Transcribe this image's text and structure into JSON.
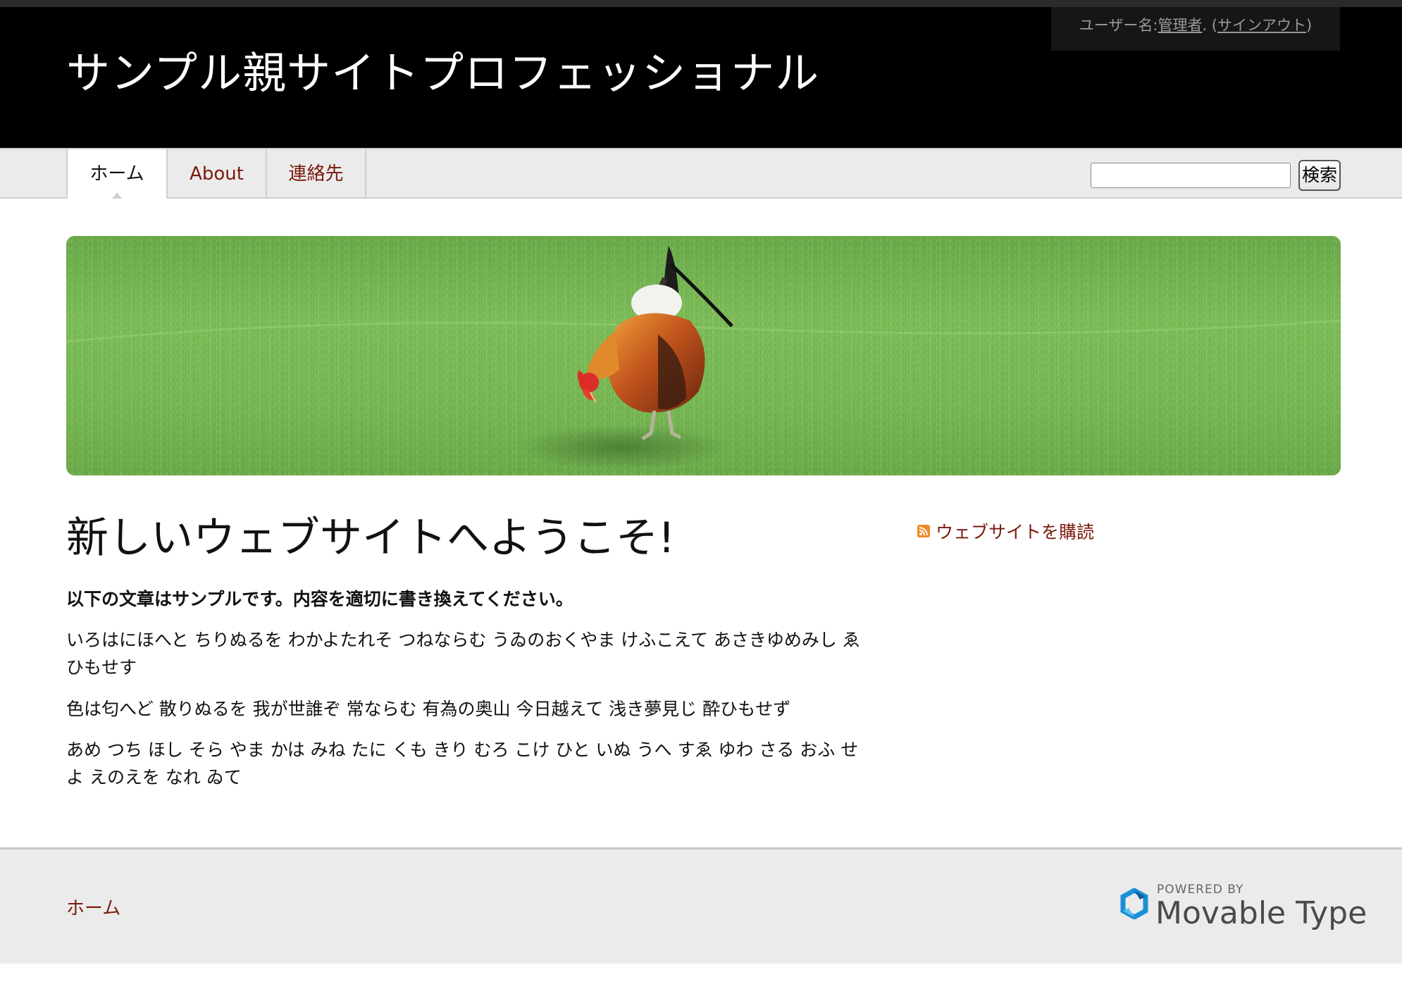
{
  "header": {
    "site_title": "サンプル親サイトプロフェッショナル",
    "user": {
      "prefix": "ユーザー名:",
      "username": "管理者",
      "separator": ". (",
      "signout": "サインアウト",
      "suffix": ")"
    }
  },
  "nav": {
    "tabs": [
      {
        "label": "ホーム",
        "active": true
      },
      {
        "label": "About",
        "active": false
      },
      {
        "label": "連絡先",
        "active": false
      }
    ],
    "search": {
      "value": "",
      "button_label": "検索"
    }
  },
  "banner": {
    "description_icon": "rooster-photo"
  },
  "main": {
    "heading": "新しいウェブサイトへようこそ!",
    "lead": "以下の文章はサンプルです。内容を適切に書き換えてください。",
    "paragraphs": [
      "いろはにほへと ちりぬるを わかよたれそ つねならむ うゐのおくやま けふこえて あさきゆめみし ゑひもせす",
      "色は匂へど 散りぬるを 我が世誰ぞ 常ならむ 有為の奥山 今日越えて 浅き夢見じ 酔ひもせず",
      "あめ つち ほし そら やま かは みね たに くも きり むろ こけ ひと いぬ うへ すゑ ゆわ さる おふ せよ えのえを なれ ゐて"
    ]
  },
  "sidebar": {
    "subscribe_label": "ウェブサイトを購読",
    "subscribe_icon": "rss-feed-icon"
  },
  "footer": {
    "home_link": "ホーム",
    "powered_by": "POWERED BY",
    "product_name": "Movable Type"
  },
  "colors": {
    "header_bg": "#000000",
    "link": "#7a1a0d",
    "nav_bg": "#ebebeb",
    "feed_orange": "#f08a24",
    "mt_blue": "#1b8fd6"
  }
}
